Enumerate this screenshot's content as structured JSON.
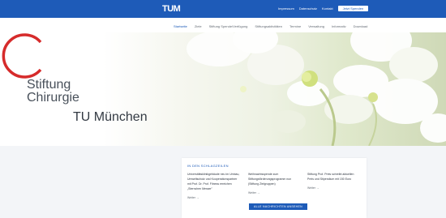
{
  "header": {
    "logo": "TUM",
    "links": [
      "Impressum",
      "Datenschutz",
      "Kontakt"
    ],
    "language_button": "Jetzt Spenden"
  },
  "nav": {
    "items": [
      "Startseite",
      "Ziele",
      "Stiftung Spende/Verfügung",
      "Stiftungsaktivitäten",
      "Termine",
      "Verwaltung",
      "Informativ",
      "Download"
    ],
    "active_index": 0
  },
  "hero": {
    "title_line1": "Stiftung",
    "title_line2": "Chirurgie",
    "subtitle": "TU München"
  },
  "news": {
    "heading": "IN DEN SCHLAGZEILEN",
    "items": [
      {
        "text": "Universitätsklinikgebäude neu im Umbau, Umweltschutz und Kooperationspartner mit Prof. Dr. Prof. Fitness erreichen „Sternchen Messer\"",
        "more": "Weiter"
      },
      {
        "text": "Weihnachtsspende zum Stiftungsförderungsprogramm nun (Stiftung Zielgruppen)",
        "more": "Weiter"
      },
      {
        "text": "Stiftung Prof. Preis schreibt aktuellen Preis und Stipendium mit 150 Euro",
        "more": "Weiter"
      }
    ],
    "all_news_button": "ALLE NACHRICHTEN ANSEHEN"
  },
  "colors": {
    "brand_blue": "#1e5bb8",
    "ring_red": "#d62b2b"
  }
}
